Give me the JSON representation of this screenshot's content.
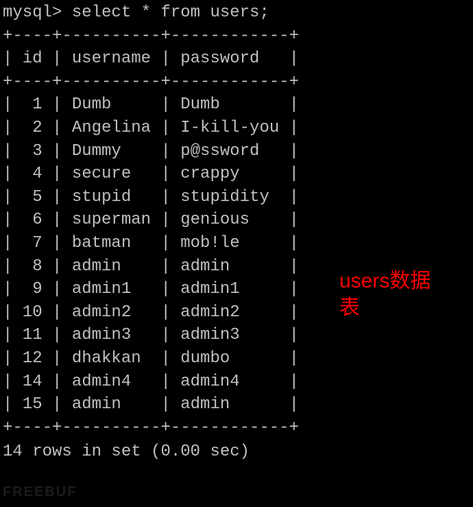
{
  "prompt": "mysql> select * from users;",
  "table": {
    "border_top": "+----+----------+------------+",
    "header": "| id | username | password   |",
    "border_mid": "+----+----------+------------+",
    "columns": [
      "id",
      "username",
      "password"
    ],
    "rows": [
      {
        "id": "1",
        "username": "Dumb",
        "password": "Dumb"
      },
      {
        "id": "2",
        "username": "Angelina",
        "password": "I-kill-you"
      },
      {
        "id": "3",
        "username": "Dummy",
        "password": "p@ssword"
      },
      {
        "id": "4",
        "username": "secure",
        "password": "crappy"
      },
      {
        "id": "5",
        "username": "stupid",
        "password": "stupidity"
      },
      {
        "id": "6",
        "username": "superman",
        "password": "genious"
      },
      {
        "id": "7",
        "username": "batman",
        "password": "mob!le"
      },
      {
        "id": "8",
        "username": "admin",
        "password": "admin"
      },
      {
        "id": "9",
        "username": "admin1",
        "password": "admin1"
      },
      {
        "id": "10",
        "username": "admin2",
        "password": "admin2"
      },
      {
        "id": "11",
        "username": "admin3",
        "password": "admin3"
      },
      {
        "id": "12",
        "username": "dhakkan",
        "password": "dumbo"
      },
      {
        "id": "14",
        "username": "admin4",
        "password": "admin4"
      },
      {
        "id": "15",
        "username": "admin",
        "password": "admin"
      }
    ],
    "border_bot": "+----+----------+------------+"
  },
  "footer": "14 rows in set (0.00 sec)",
  "annotation": "users数据表",
  "watermark": "FREEBUF",
  "col_widths": {
    "id": 4,
    "username": 10,
    "password": 12
  }
}
